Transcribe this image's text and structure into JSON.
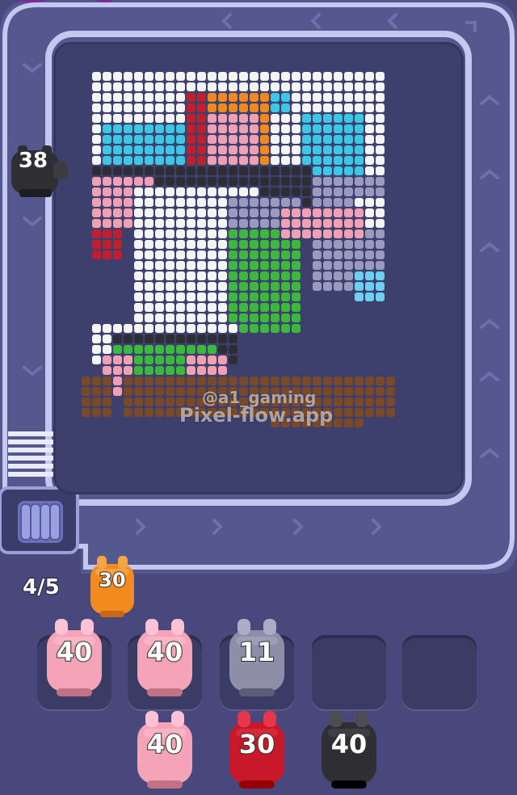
{
  "conveyor": {
    "queue_counter": "4/5",
    "active_pig": {
      "value": "38",
      "color": "#2e2e33"
    }
  },
  "board": {
    "watermark_line1": "@a1_gaming",
    "watermark_line2": "Pixel-flow.app"
  },
  "queue_pig": {
    "value": "30",
    "color": "#f28a1e"
  },
  "slots": [
    {
      "value": "40",
      "color": "#f5a3b6"
    },
    {
      "value": "40",
      "color": "#f5a3b6"
    },
    {
      "value": "11",
      "color": "#8e8ea8"
    },
    {
      "value": "",
      "color": ""
    },
    {
      "value": "",
      "color": ""
    }
  ],
  "shelf": [
    {
      "value": "40",
      "color": "#f5a3b6"
    },
    {
      "value": "30",
      "color": "#c8182a"
    },
    {
      "value": "40",
      "color": "#2e2e33"
    }
  ],
  "colors": {
    "background": "#48487c",
    "track": "#5a5d9a",
    "track_border": "#b7bde8",
    "board": "#3d3f6c"
  }
}
